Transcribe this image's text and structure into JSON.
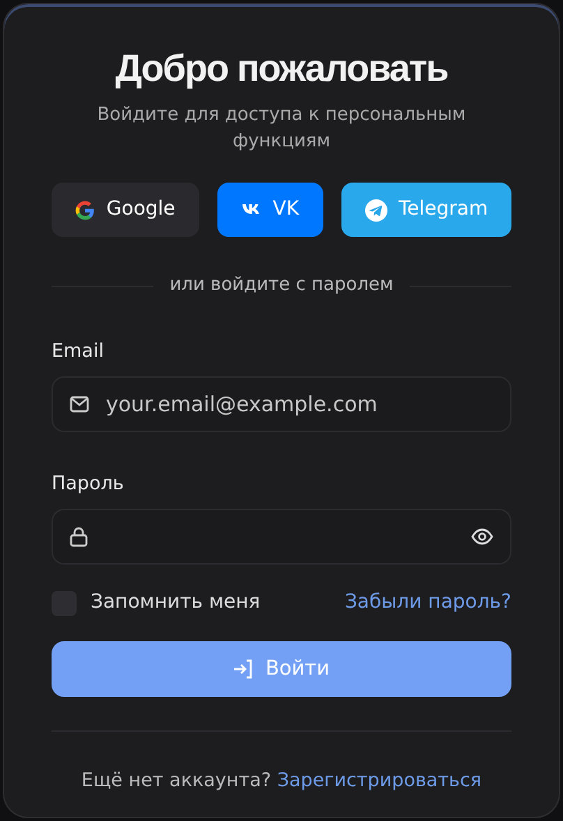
{
  "title": "Добро пожаловать",
  "subtitle": "Войдите для доступа к персональным функциям",
  "social_buttons": [
    {
      "kind": "google",
      "label": "Google"
    },
    {
      "kind": "vk",
      "label": "VK"
    },
    {
      "kind": "telegram",
      "label": "Telegram"
    }
  ],
  "divider_text": "или войдите с паролем",
  "email": {
    "label": "Email",
    "placeholder": "your.email@example.com"
  },
  "password": {
    "label": "Пароль"
  },
  "remember": {
    "label": "Запомнить меня",
    "checked": false
  },
  "forgot_link": "Забыли пароль?",
  "submit": "Войти",
  "footer": {
    "text": "Ещё нет аккаунта?",
    "link": "Зарегистрироваться"
  }
}
